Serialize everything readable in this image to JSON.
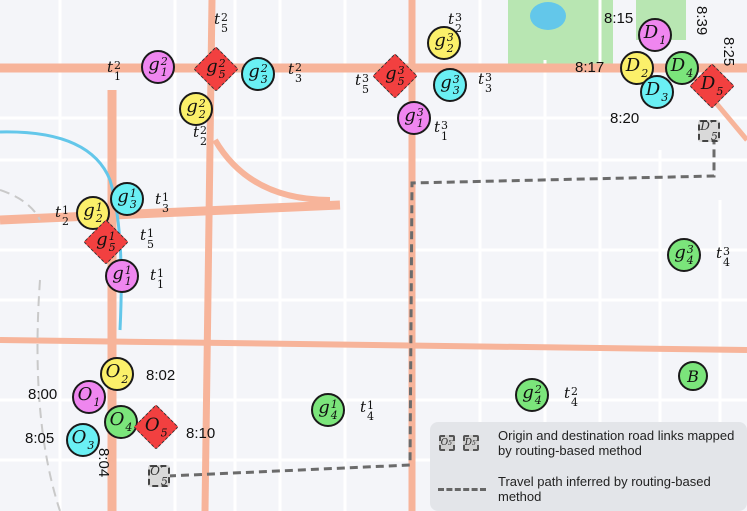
{
  "colors": {
    "g1": "#ef86ef",
    "g2": "#fbf06a",
    "g3": "#6af0f4",
    "g4": "#7be57b",
    "g5": "#f24040",
    "road_major": "#f7b49a",
    "road_minor": "#ffffff",
    "water": "#63c7ea",
    "park": "#b8e6b2",
    "background": "#f4f5f9"
  },
  "groups": {
    "g1": [
      {
        "id": "g1_1",
        "base": "g",
        "sub": "1",
        "sup": "1",
        "color": "g1",
        "label_base": "t",
        "label_sub": "1",
        "label_sup": "1"
      },
      {
        "id": "g1_2",
        "base": "g",
        "sub": "1",
        "sup": "2",
        "color": "g1",
        "label_base": "t",
        "label_sub": "1",
        "label_sup": "2"
      },
      {
        "id": "g1_3",
        "base": "g",
        "sub": "1",
        "sup": "3",
        "color": "g1",
        "label_base": "t",
        "label_sub": "1",
        "label_sup": "3"
      }
    ],
    "g2": [
      {
        "id": "g2_1",
        "base": "g",
        "sub": "2",
        "sup": "1",
        "color": "g2",
        "label_base": "t",
        "label_sub": "2",
        "label_sup": "1"
      },
      {
        "id": "g2_2",
        "base": "g",
        "sub": "2",
        "sup": "2",
        "color": "g2",
        "label_base": "t",
        "label_sub": "2",
        "label_sup": "2"
      },
      {
        "id": "g2_3",
        "base": "g",
        "sub": "2",
        "sup": "3",
        "color": "g2",
        "label_base": "t",
        "label_sub": "2",
        "label_sup": "3"
      }
    ],
    "g3": [
      {
        "id": "g3_1",
        "base": "g",
        "sub": "3",
        "sup": "1",
        "color": "g3",
        "label_base": "t",
        "label_sub": "3",
        "label_sup": "1"
      },
      {
        "id": "g3_2",
        "base": "g",
        "sub": "3",
        "sup": "2",
        "color": "g3",
        "label_base": "t",
        "label_sub": "3",
        "label_sup": "2"
      },
      {
        "id": "g3_3",
        "base": "g",
        "sub": "3",
        "sup": "3",
        "color": "g3",
        "label_base": "t",
        "label_sub": "3",
        "label_sup": "3"
      }
    ],
    "g4": [
      {
        "id": "g4_1",
        "base": "g",
        "sub": "4",
        "sup": "1",
        "color": "g4",
        "label_base": "t",
        "label_sub": "4",
        "label_sup": "1"
      },
      {
        "id": "g4_2",
        "base": "g",
        "sub": "4",
        "sup": "2",
        "color": "g4",
        "label_base": "t",
        "label_sub": "4",
        "label_sup": "2"
      },
      {
        "id": "g4_3",
        "base": "g",
        "sub": "4",
        "sup": "3",
        "color": "g4",
        "label_base": "t",
        "label_sub": "4",
        "label_sup": "3"
      }
    ],
    "g5": [
      {
        "id": "g5_1",
        "base": "g",
        "sub": "5",
        "sup": "1",
        "color": "g5",
        "label_base": "t",
        "label_sub": "5",
        "label_sup": "1"
      },
      {
        "id": "g5_2",
        "base": "g",
        "sub": "5",
        "sup": "2",
        "color": "g5",
        "label_base": "t",
        "label_sub": "5",
        "label_sup": "2"
      },
      {
        "id": "g5_3",
        "base": "g",
        "sub": "5",
        "sup": "3",
        "color": "g5",
        "label_base": "t",
        "label_sub": "5",
        "label_sup": "3"
      }
    ]
  },
  "origins": [
    {
      "id": "O1",
      "base": "O",
      "sub": "1",
      "color": "g1",
      "time": "8:00"
    },
    {
      "id": "O2",
      "base": "O",
      "sub": "2",
      "color": "g2",
      "time": "8:02"
    },
    {
      "id": "O3",
      "base": "O",
      "sub": "3",
      "color": "g3",
      "time": "8:05"
    },
    {
      "id": "O4",
      "base": "O",
      "sub": "4",
      "color": "g4",
      "time": "8:04"
    },
    {
      "id": "O5",
      "base": "O",
      "sub": "5",
      "color": "g5",
      "time": "8:10"
    }
  ],
  "destinations": [
    {
      "id": "D1",
      "base": "D",
      "sub": "1",
      "color": "g1",
      "time": "8:15"
    },
    {
      "id": "D2",
      "base": "D",
      "sub": "2",
      "color": "g2",
      "time": "8:17"
    },
    {
      "id": "D3",
      "base": "D",
      "sub": "3",
      "color": "g3",
      "time": "8:20"
    },
    {
      "id": "D4",
      "base": "D",
      "sub": "4",
      "color": "g4",
      "time": "8:39"
    },
    {
      "id": "D5",
      "base": "D",
      "sub": "5",
      "color": "g5",
      "time": "8:25"
    }
  ],
  "mapped_links": [
    {
      "id": "O5p",
      "base": "O",
      "sub": "5",
      "sup": "′"
    },
    {
      "id": "D5p",
      "base": "D",
      "sub": "5",
      "sup": "′"
    }
  ],
  "b_marker": {
    "label": "B",
    "color": "g4"
  },
  "legend": {
    "mini_origin": {
      "base": "O",
      "sub": "5",
      "sup": "′"
    },
    "mini_dest": {
      "base": "D",
      "sub": "5",
      "sup": "′"
    },
    "row1": "Origin and destination road links mapped by routing-based method",
    "row2": "Travel path inferred by routing-based method"
  }
}
